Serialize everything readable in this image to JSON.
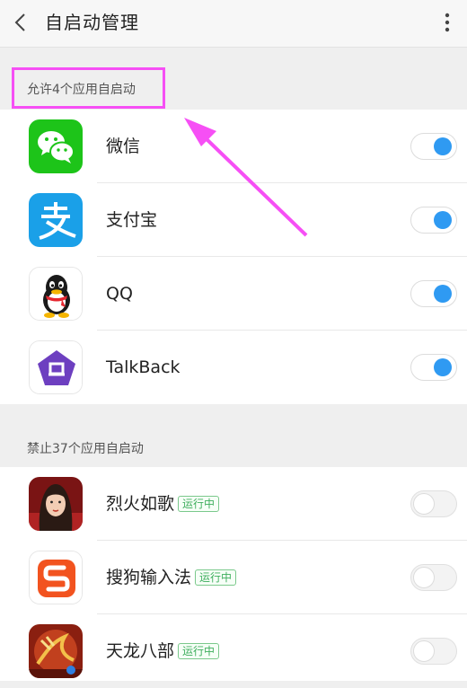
{
  "header": {
    "title": "自启动管理",
    "back_icon": "chevron-left-icon",
    "more_icon": "more-vertical-icon"
  },
  "allowed": {
    "label": "允许4个应用自启动",
    "highlight_color": "#f64ff5",
    "apps": [
      {
        "name": "微信",
        "icon": "wechat-icon",
        "enabled": true
      },
      {
        "name": "支付宝",
        "icon": "alipay-icon",
        "enabled": true
      },
      {
        "name": "QQ",
        "icon": "qq-icon",
        "enabled": true
      },
      {
        "name": "TalkBack",
        "icon": "talkback-icon",
        "enabled": true
      }
    ]
  },
  "blocked": {
    "label": "禁止37个应用自启动",
    "apps": [
      {
        "name": "烈火如歌",
        "badge": "运行中",
        "icon": "liehuo-rug-icon",
        "enabled": false
      },
      {
        "name": "搜狗输入法",
        "badge": "运行中",
        "icon": "sogou-input-icon",
        "enabled": false
      },
      {
        "name": "天龙八部",
        "badge": "运行中",
        "icon": "tianlong-babu-icon",
        "enabled": false
      }
    ]
  },
  "colors": {
    "toggle_on": "#2f9af2",
    "badge_green": "#3fae5e",
    "annotation_magenta": "#f64ff5"
  }
}
